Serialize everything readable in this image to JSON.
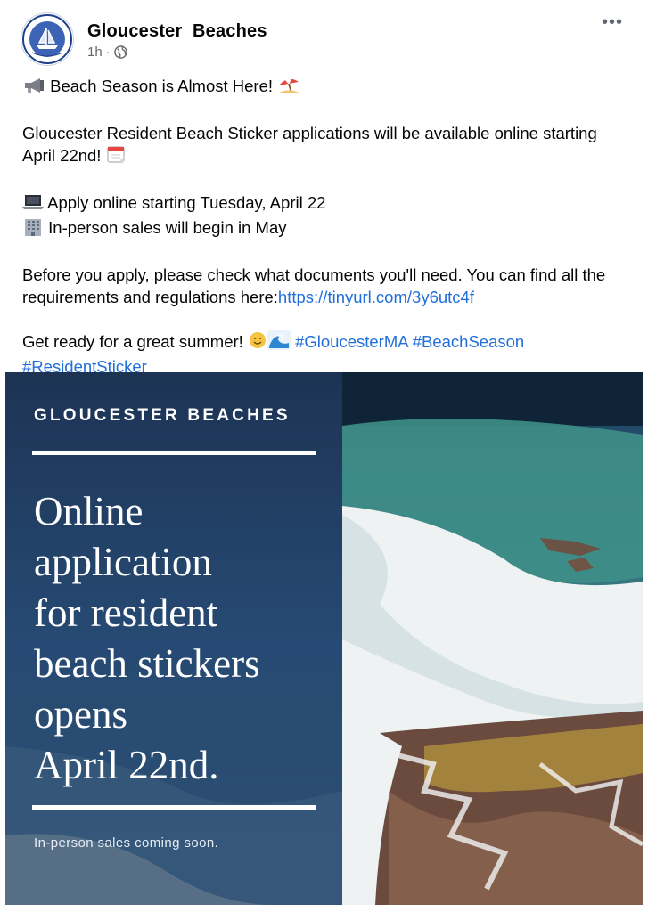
{
  "post": {
    "page_name": "Gloucester  Beaches",
    "time": "1h",
    "separator": "·",
    "more_label": "•••"
  },
  "body": {
    "line1": "Beach Season is Almost Here!",
    "line2": "Gloucester Resident Beach Sticker applications will be available online starting April 22nd!",
    "line3": "Apply online starting Tuesday, April 22",
    "line4": "In-person sales will begin in May",
    "line5": "Before you apply, please check what documents you'll need. You can find all the requirements and regulations here:",
    "link": "https://tinyurl.com/3y6utc4f",
    "line6": "Get ready for a great summer!",
    "hashtags": [
      "#GloucesterMA",
      "#BeachSeason",
      "#ResidentSticker"
    ]
  },
  "image": {
    "brand": "GLOUCESTER BEACHES",
    "headline": "Online\napplication\nfor resident\nbeach stickers\nopens\nApril 22nd.",
    "subtext": "In-person sales coming soon."
  },
  "icons": [
    "gloucester-seal-icon",
    "globe-icon",
    "more-options-icon",
    "megaphone-icon",
    "beach-umbrella-icon",
    "calendar-icon",
    "laptop-icon",
    "office-building-icon",
    "sun-face-icon",
    "wave-icon"
  ],
  "colors": {
    "link": "#216fdb",
    "meta": "#65676b",
    "panel": "#1f3a63"
  }
}
